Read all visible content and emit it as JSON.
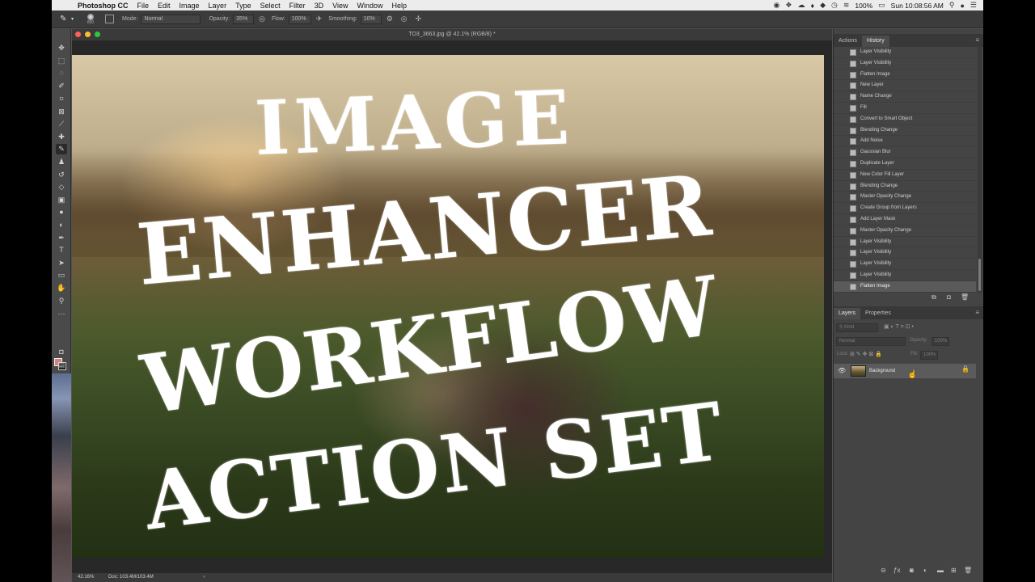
{
  "menubar": {
    "app_name": "Photoshop CC",
    "menus": [
      "File",
      "Edit",
      "Image",
      "Layer",
      "Type",
      "Select",
      "Filter",
      "3D",
      "View",
      "Window",
      "Help"
    ],
    "battery": "100%",
    "clock": "Sun 10:08:56 AM"
  },
  "options": {
    "brush_size": "800",
    "mode_label": "Mode:",
    "mode_value": "Normal",
    "opacity_label": "Opacity:",
    "opacity_value": "35%",
    "flow_label": "Flow:",
    "flow_value": "100%",
    "smoothing_label": "Smoothing:",
    "smoothing_value": "10%"
  },
  "document": {
    "title": "TO3_3663.jpg @ 42.1% (RGB/8) *",
    "overlay_lines": [
      "IMAGE",
      "ENHANCER",
      "WORKFLOW",
      "ACTION SET"
    ],
    "zoom": "42.16%",
    "doc_size": "Doc: 103.4M/103.4M"
  },
  "history_panel": {
    "tabs": [
      "Actions",
      "History"
    ],
    "active_tab": "History",
    "items": [
      "Layer Visibility",
      "Layer Visibility",
      "Flatten Image",
      "New Layer",
      "Name Change",
      "Fill",
      "Convert to Smart Object",
      "Blending Change",
      "Add Noise",
      "Gaussian Blur",
      "Duplicate Layer",
      "New Color Fill Layer",
      "Blending Change",
      "Master Opacity Change",
      "Create Group from Layers",
      "Add Layer Mask",
      "Master Opacity Change",
      "Layer Visibility",
      "Layer Visibility",
      "Layer Visibility",
      "Layer Visibility",
      "Flatten Image"
    ]
  },
  "layers_panel": {
    "tabs": [
      "Layers",
      "Properties"
    ],
    "active_tab": "Layers",
    "filter_placeholder": "Kind",
    "blend_mode": "Normal",
    "opacity_label": "Opacity:",
    "opacity_value": "100%",
    "lock_label": "Lock:",
    "fill_label": "Fill:",
    "fill_value": "100%",
    "layers": [
      {
        "name": "Background"
      }
    ]
  },
  "colors": {
    "foreground": "#d88080",
    "background": "#111111",
    "panel": "#444444"
  }
}
